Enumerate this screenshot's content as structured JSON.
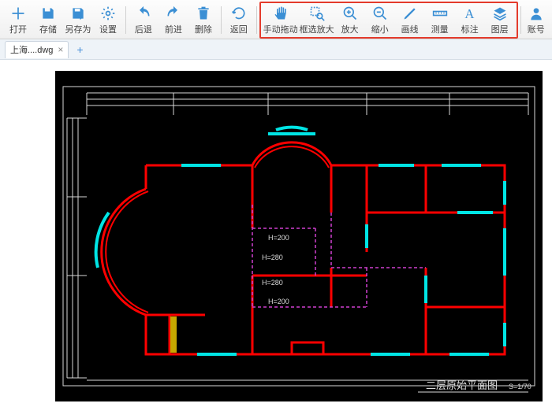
{
  "toolbar": {
    "groups": {
      "file": [
        {
          "name": "open-button",
          "icon": "plus",
          "label": "打开"
        },
        {
          "name": "save-button",
          "icon": "save",
          "label": "存储"
        },
        {
          "name": "saveas-button",
          "icon": "saveas",
          "label": "另存为"
        },
        {
          "name": "settings-button",
          "icon": "gear",
          "label": "设置"
        }
      ],
      "nav": [
        {
          "name": "back-button",
          "icon": "undo",
          "label": "后退"
        },
        {
          "name": "forward-button",
          "icon": "redo",
          "label": "前进"
        },
        {
          "name": "delete-button",
          "icon": "trash",
          "label": "删除"
        }
      ],
      "ret": [
        {
          "name": "return-button",
          "icon": "return",
          "label": "返回"
        }
      ],
      "view": [
        {
          "name": "pan-button",
          "icon": "hand",
          "label": "手动拖动"
        },
        {
          "name": "zoom-window-button",
          "icon": "zoomwin",
          "label": "框选放大"
        },
        {
          "name": "zoom-in-button",
          "icon": "zoomin",
          "label": "放大"
        },
        {
          "name": "zoom-out-button",
          "icon": "zoomout",
          "label": "缩小"
        },
        {
          "name": "draw-line-button",
          "icon": "pencil",
          "label": "画线"
        },
        {
          "name": "measure-button",
          "icon": "measure",
          "label": "测量"
        },
        {
          "name": "annotate-button",
          "icon": "text",
          "label": "标注"
        },
        {
          "name": "layers-button",
          "icon": "layers",
          "label": "图层"
        }
      ]
    },
    "account_label": "账号"
  },
  "tabs": [
    {
      "name": "上海....dwg"
    }
  ],
  "drawing": {
    "annotations": {
      "h200_a": "H=200",
      "h280_a": "H=280",
      "h280_b": "H=280",
      "h200_b": "H=200"
    },
    "title": "二层原始平面图",
    "scale": "S=1/70",
    "colors": {
      "wall": "#ff0000",
      "door": "#00e5e5",
      "dash": "#d040d0",
      "frame": "#d8d8d8",
      "fill_yellow": "#c8a800"
    }
  }
}
